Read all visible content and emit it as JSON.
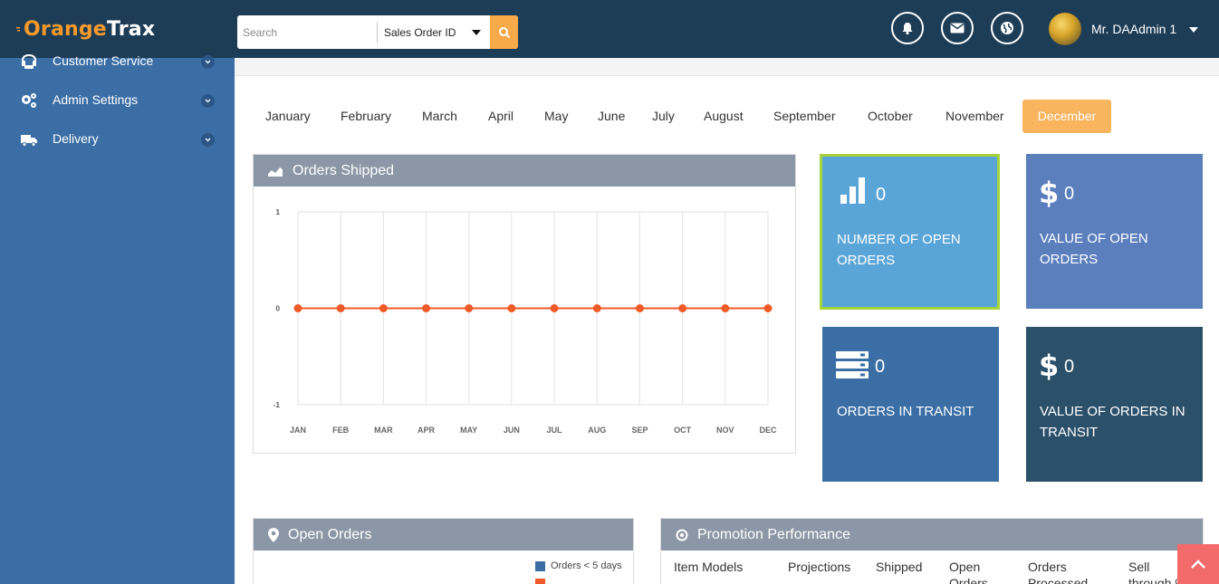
{
  "header": {
    "logo_part1": "O",
    "logo_part2": "range",
    "logo_part3": "Trax",
    "search_placeholder": "Search",
    "search_filter": "Sales Order ID",
    "user_name": "Mr. DAAdmin 1"
  },
  "sidebar": {
    "items": [
      {
        "label": "Customer Service",
        "icon": "headset-icon"
      },
      {
        "label": "Admin Settings",
        "icon": "gears-icon"
      },
      {
        "label": "Delivery",
        "icon": "truck-icon"
      }
    ]
  },
  "months": [
    "January",
    "February",
    "March",
    "April",
    "May",
    "June",
    "July",
    "August",
    "September",
    "October",
    "November",
    "December"
  ],
  "selected_month": "December",
  "orders_shipped": {
    "title": "Orders Shipped",
    "chart_data": {
      "type": "line",
      "categories": [
        "JAN",
        "FEB",
        "MAR",
        "APR",
        "MAY",
        "JUN",
        "JUL",
        "AUG",
        "SEP",
        "OCT",
        "NOV",
        "DEC"
      ],
      "values": [
        0,
        0,
        0,
        0,
        0,
        0,
        0,
        0,
        0,
        0,
        0,
        0
      ],
      "ylim": [
        -1,
        1
      ],
      "yticks": [
        "1",
        "0",
        "-1"
      ],
      "grid": true,
      "line_color": "#f05a28"
    }
  },
  "kpis": {
    "open_orders": {
      "value": "0",
      "label_line1": "NUMBER OF OPEN",
      "label_line2": "ORDERS",
      "color": "#5aa5d8"
    },
    "open_value": {
      "symbol": "$",
      "value": "0",
      "label_line1": "VALUE OF OPEN",
      "label_line2": "ORDERS",
      "color": "#5b7fbd"
    },
    "transit": {
      "value": "0",
      "label_line1": "ORDERS IN TRANSIT",
      "label_line2": "",
      "color": "#3a6ea5"
    },
    "transit_value": {
      "symbol": "$",
      "value": "0",
      "label_line1": "VALUE OF ORDERS IN",
      "label_line2": "TRANSIT",
      "color": "#2b506a"
    }
  },
  "open_orders_panel": {
    "title": "Open Orders",
    "legend_1": "Orders < 5 days"
  },
  "promotion_panel": {
    "title": "Promotion Performance",
    "columns": [
      "Item Models",
      "Projections",
      "Shipped",
      "Open",
      "Orders",
      "Sell"
    ],
    "columns_line2": [
      "",
      "",
      "",
      "Orders",
      "Processed",
      "through %"
    ]
  }
}
